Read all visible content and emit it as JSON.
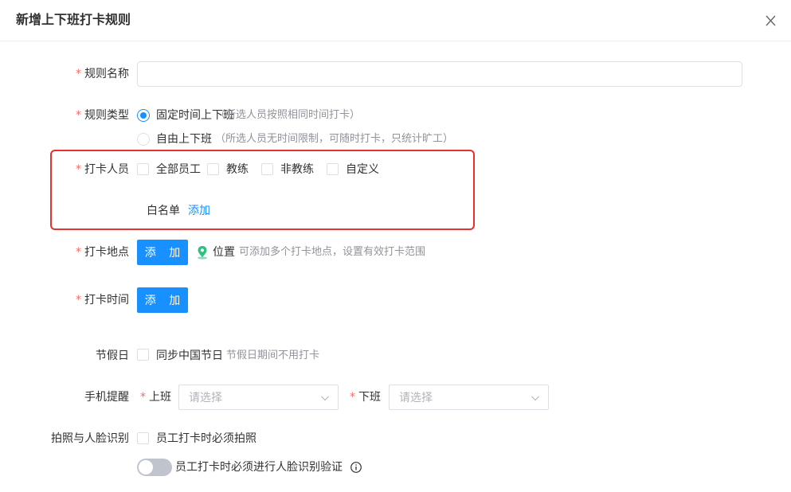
{
  "dialog": {
    "title": "新增上下班打卡规则",
    "close_icon": "close-icon"
  },
  "colors": {
    "primary": "#1890ff",
    "required": "#f56c6c",
    "highlight": "#e5312f"
  },
  "form": {
    "required_mark": "*",
    "rule_name": {
      "label": "规则名称",
      "value": ""
    },
    "rule_type": {
      "label": "规则类型",
      "options": [
        {
          "label": "固定时间上下班",
          "hint": "（所选人员按照相同时间打卡）",
          "checked": true
        },
        {
          "label": "自由上下班",
          "hint": "（所选人员无时间限制，可随时打卡，只统计旷工）",
          "checked": false
        }
      ]
    },
    "clock_staff": {
      "label": "打卡人员",
      "options": [
        "全部员工",
        "教练",
        "非教练",
        "自定义"
      ],
      "whitelist_label": "白名单",
      "whitelist_add": "添加"
    },
    "clock_location": {
      "label": "打卡地点",
      "add_button": "添 加",
      "location_icon": "map-pin-icon",
      "location_label": "位置",
      "location_hint": "可添加多个打卡地点，设置有效打卡范围"
    },
    "clock_time": {
      "label": "打卡时间",
      "add_button": "添 加"
    },
    "holiday": {
      "label": "节假日",
      "checkbox_label": "同步中国节日",
      "hint": "节假日期间不用打卡"
    },
    "reminder": {
      "label": "手机提醒",
      "on_duty_label": "上班",
      "on_duty_placeholder": "请选择",
      "off_duty_label": "下班",
      "off_duty_placeholder": "请选择"
    },
    "photo_face": {
      "label": "拍照与人脸识别",
      "photo_checkbox_label": "员工打卡时必须拍照",
      "face_toggle_label": "员工打卡时必须进行人脸识别验证",
      "face_toggle_on": false,
      "info_icon": "info-icon"
    }
  }
}
